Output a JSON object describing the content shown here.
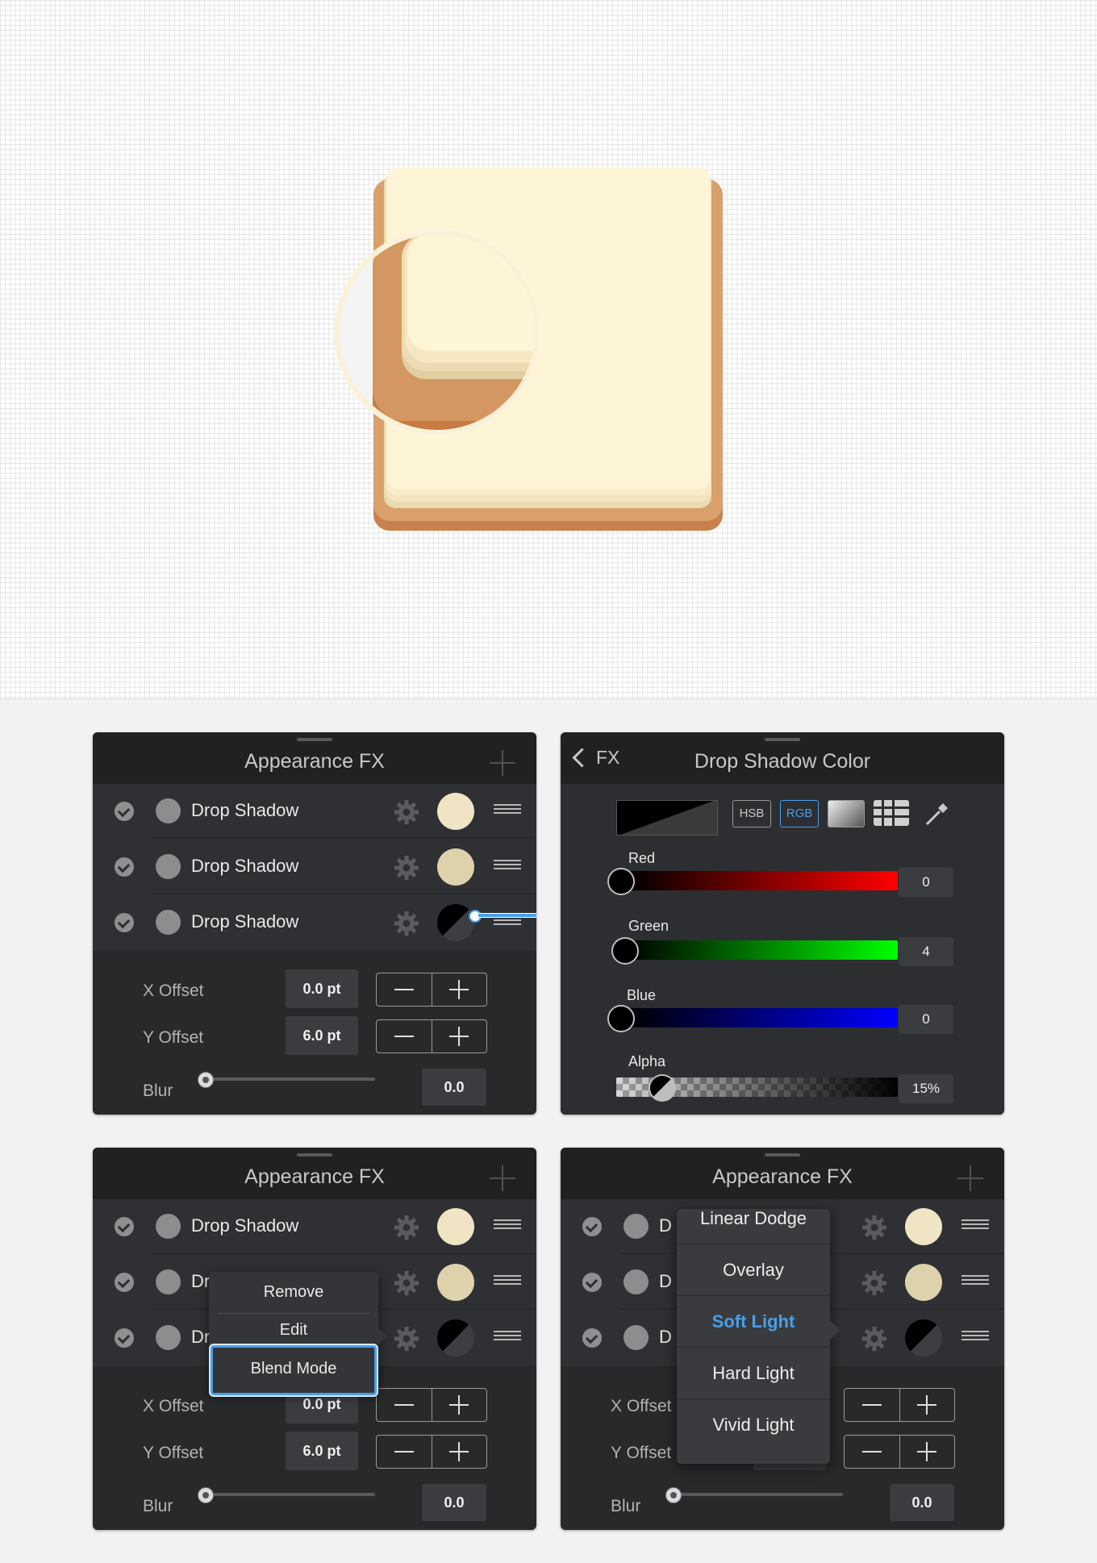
{
  "panel_tl": {
    "title": "Appearance FX",
    "rows": [
      {
        "label": "Drop Shadow",
        "swatch": "#efe4c4"
      },
      {
        "label": "Drop Shadow",
        "swatch": "#ddd2ac"
      },
      {
        "label": "Drop Shadow",
        "swatch": "half-black"
      }
    ],
    "x_offset_label": "X Offset",
    "x_offset_value": "0.0 pt",
    "y_offset_label": "Y Offset",
    "y_offset_value": "6.0 pt",
    "blur_label": "Blur",
    "blur_value": "0.0"
  },
  "panel_tr": {
    "back_label": "FX",
    "title": "Drop Shadow Color",
    "hsb_label": "HSB",
    "rgb_label": "RGB",
    "channels": [
      {
        "label": "Red",
        "value": "0"
      },
      {
        "label": "Green",
        "value": "4"
      },
      {
        "label": "Blue",
        "value": "0"
      },
      {
        "label": "Alpha",
        "value": "15%"
      }
    ]
  },
  "panel_bl": {
    "title": "Appearance FX",
    "rows": [
      {
        "label": "Drop Shadow",
        "swatch": "#efe4c4"
      },
      {
        "label": "Dr",
        "swatch": "#ddd2ac"
      },
      {
        "label": "Dr",
        "swatch": "half-black"
      }
    ],
    "menu": [
      "Remove",
      "Edit",
      "Blend Mode"
    ],
    "x_offset_label": "X Offset",
    "x_offset_value": "0.0 pt",
    "y_offset_label": "Y Offset",
    "y_offset_value": "6.0 pt",
    "blur_label": "Blur",
    "blur_value": "0.0"
  },
  "panel_br": {
    "title": "Appearance FX",
    "rows": [
      {
        "label": "D",
        "swatch": "#efe4c4"
      },
      {
        "label": "D",
        "swatch": "#ddd2ac"
      },
      {
        "label": "D",
        "swatch": "half-black"
      }
    ],
    "blend_modes": [
      "Linear Dodge",
      "Overlay",
      "Soft Light",
      "Hard Light",
      "Vivid Light"
    ],
    "selected_blend_mode": "Soft Light",
    "x_offset_label": "X Offset",
    "y_offset_label": "Y Offset",
    "blur_label": "Blur",
    "blur_value": "0.0"
  },
  "colors": {
    "accent_blue": "#4a9fe8",
    "panel_bg": "#28292b",
    "cream": "#fef5d6",
    "tan": "#d59b62"
  }
}
